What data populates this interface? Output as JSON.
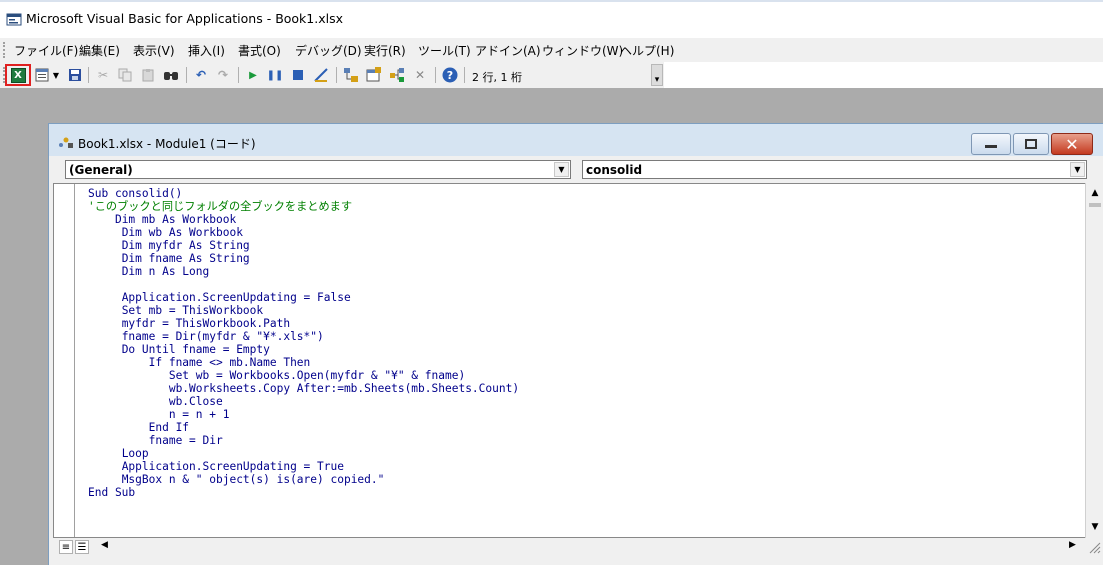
{
  "window": {
    "title": "Microsoft Visual Basic for Applications - Book1.xlsx"
  },
  "menu": [
    "ファイル(F)",
    "編集(E)",
    "表示(V)",
    "挿入(I)",
    "書式(O)",
    "デバッグ(D)",
    "実行(R)",
    "ツール(T)",
    "アドイン(A)",
    "ウィンドウ(W)",
    "ヘルプ(H)"
  ],
  "toolbar": {
    "icons": [
      "excel-view-icon",
      "insert-module-icon",
      "save-icon",
      "cut-icon",
      "copy-icon",
      "paste-icon",
      "find-icon",
      "undo-icon",
      "redo-icon",
      "run-icon",
      "break-icon",
      "reset-icon",
      "design-mode-icon",
      "project-explorer-icon",
      "properties-icon",
      "object-browser-icon",
      "toolbox-icon",
      "help-icon"
    ],
    "cursor_position": "2 行, 1 桁"
  },
  "code_window": {
    "title": "Book1.xlsx - Module1 (コード)",
    "object_combo": "(General)",
    "procedure_combo": "consolid",
    "lines": [
      {
        "indent": "",
        "parts": [
          {
            "t": "Sub consolid()",
            "c": "kw"
          }
        ]
      },
      {
        "indent": "",
        "parts": [
          {
            "t": "'このブックと同じフォルダの全ブックをまとめます",
            "c": "cm"
          }
        ]
      },
      {
        "indent": "    ",
        "parts": [
          {
            "t": "Dim mb As Workbook",
            "c": "kw"
          }
        ]
      },
      {
        "indent": "     ",
        "parts": [
          {
            "t": "Dim wb As Workbook",
            "c": "kw"
          }
        ]
      },
      {
        "indent": "     ",
        "parts": [
          {
            "t": "Dim myfdr As String",
            "c": "kw"
          }
        ]
      },
      {
        "indent": "     ",
        "parts": [
          {
            "t": "Dim fname As String",
            "c": "kw"
          }
        ]
      },
      {
        "indent": "     ",
        "parts": [
          {
            "t": "Dim n As Long",
            "c": "kw"
          }
        ]
      },
      {
        "indent": "",
        "parts": []
      },
      {
        "indent": "     ",
        "parts": [
          {
            "t": "Application.ScreenUpdating = False",
            "c": "kw"
          }
        ]
      },
      {
        "indent": "     ",
        "parts": [
          {
            "t": "Set mb = ThisWorkbook",
            "c": "kw"
          }
        ]
      },
      {
        "indent": "     ",
        "parts": [
          {
            "t": "myfdr = ThisWorkbook.Path",
            "c": "kw"
          }
        ]
      },
      {
        "indent": "     ",
        "parts": [
          {
            "t": "fname = Dir(myfdr & \"¥*.xls*\")",
            "c": "kw"
          }
        ]
      },
      {
        "indent": "     ",
        "parts": [
          {
            "t": "Do Until fname = Empty",
            "c": "kw"
          }
        ]
      },
      {
        "indent": "         ",
        "parts": [
          {
            "t": "If fname <> mb.Name Then",
            "c": "kw"
          }
        ]
      },
      {
        "indent": "            ",
        "parts": [
          {
            "t": "Set wb = Workbooks.Open(myfdr & \"¥\" & fname)",
            "c": "kw"
          }
        ]
      },
      {
        "indent": "            ",
        "parts": [
          {
            "t": "wb.Worksheets.Copy After:=mb.Sheets(mb.Sheets.Count)",
            "c": "kw"
          }
        ]
      },
      {
        "indent": "            ",
        "parts": [
          {
            "t": "wb.Close",
            "c": "kw"
          }
        ]
      },
      {
        "indent": "            ",
        "parts": [
          {
            "t": "n = n + 1",
            "c": "kw"
          }
        ]
      },
      {
        "indent": "         ",
        "parts": [
          {
            "t": "End If",
            "c": "kw"
          }
        ]
      },
      {
        "indent": "         ",
        "parts": [
          {
            "t": "fname = Dir",
            "c": "kw"
          }
        ]
      },
      {
        "indent": "     ",
        "parts": [
          {
            "t": "Loop",
            "c": "kw"
          }
        ]
      },
      {
        "indent": "     ",
        "parts": [
          {
            "t": "Application.ScreenUpdating = True",
            "c": "kw"
          }
        ]
      },
      {
        "indent": "     ",
        "parts": [
          {
            "t": "MsgBox n & \" object(s) is(are) copied.\"",
            "c": "kw"
          }
        ]
      },
      {
        "indent": "",
        "parts": [
          {
            "t": "End Sub",
            "c": "kw"
          }
        ]
      }
    ]
  },
  "colors": {
    "keyword": "#00008b",
    "comment": "#008000",
    "workspace": "#ababab",
    "highlight_box": "#e02020"
  }
}
